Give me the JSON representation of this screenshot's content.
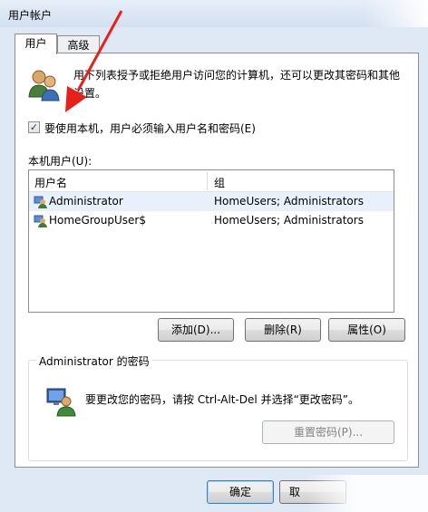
{
  "window": {
    "title": "用户帐户"
  },
  "tabs": [
    {
      "label": "用户",
      "active": true
    },
    {
      "label": "高级",
      "active": false
    }
  ],
  "intro_text": "用下列表授予或拒绝用户访问您的计算机，还可以更改其密码和其他设置。",
  "require_login": {
    "checked": true,
    "mark": "✓",
    "label": "要使用本机，用户必须输入用户名和密码(E)"
  },
  "local_users": {
    "label": "本机用户(U):",
    "columns": [
      "用户名",
      "组"
    ],
    "rows": [
      {
        "name": "Administrator",
        "group": "HomeUsers; Administrators",
        "selected": true
      },
      {
        "name": "HomeGroupUser$",
        "group": "HomeUsers; Administrators",
        "selected": false
      }
    ]
  },
  "buttons": {
    "add": "添加(D)...",
    "remove": "删除(R)",
    "properties": "属性(O)"
  },
  "password_group": {
    "legend": "Administrator 的密码",
    "message": "要更改您的密码，请按 Ctrl-Alt-Del 并选择“更改密码”。",
    "reset_button": "重置密码(P)..."
  },
  "footer": {
    "ok": "确定",
    "cancel": "取"
  },
  "colors": {
    "selection": "#e8f1fb",
    "arrow": "#e8201a",
    "frame": "#dfe9f6"
  }
}
